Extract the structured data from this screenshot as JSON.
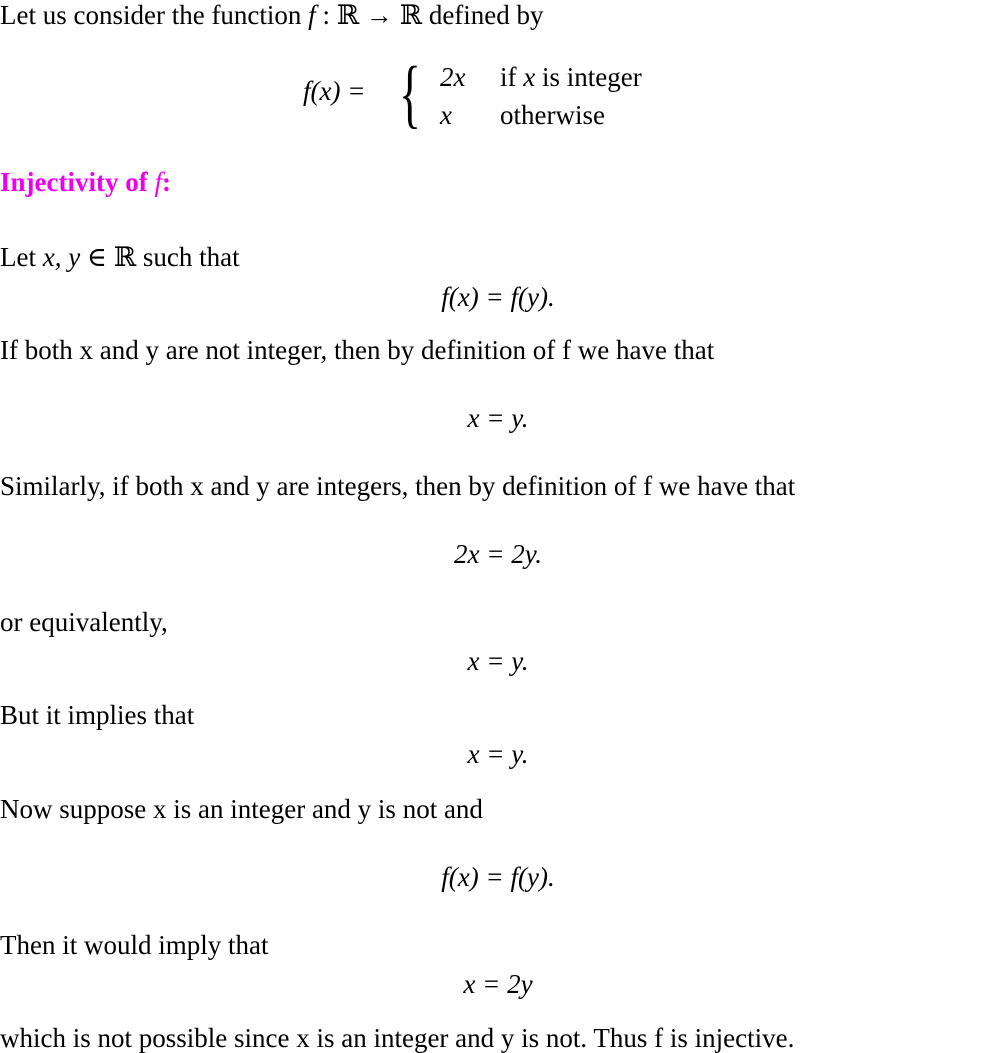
{
  "intro": {
    "before": "Let us consider the function ",
    "f": "f",
    "mapping": " : ℝ → ℝ ",
    "after": "defined by"
  },
  "definition": {
    "lhs": "f(x) =",
    "cases": [
      {
        "expr": "2x",
        "cond_pre": "if ",
        "cond_var": "x",
        "cond_post": " is integer"
      },
      {
        "expr": "x",
        "cond_pre": "otherwise",
        "cond_var": "",
        "cond_post": ""
      }
    ]
  },
  "heading": {
    "text": "Injectivity of ",
    "var": "f",
    "colon": ":",
    "color": "#ee00ee"
  },
  "lines": [
    {
      "pre": "Let ",
      "math": "x, y",
      "post": " ∈ ℝ such that"
    },
    {
      "eq": "f(x) = f(y)."
    },
    {
      "text": "If both x and y are not integer, then by definition of f we have that"
    },
    {
      "eq": "x = y."
    },
    {
      "text": "Similarly, if both x and y are integers, then by definition of f we have that"
    },
    {
      "eq": "2x = 2y."
    },
    {
      "text": "or equivalently,"
    },
    {
      "eq": "x = y."
    },
    {
      "text": "But it implies that"
    },
    {
      "eq": "x = y."
    },
    {
      "text": "Now suppose x is an integer and y is not and"
    },
    {
      "eq": "f(x) = f(y)."
    },
    {
      "text": "Then it would imply that"
    },
    {
      "eq": "x = 2y"
    },
    {
      "text": "which is not possible since x is an integer and y is not. Thus f is injective."
    }
  ]
}
